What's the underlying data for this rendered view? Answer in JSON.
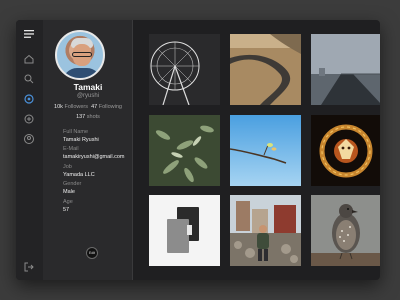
{
  "profile": {
    "name": "Tamaki",
    "handle": "@ryushi",
    "followers_count": "10k",
    "followers_label": "Followers",
    "following_count": "47",
    "following_label": "Following",
    "shots_count": "137",
    "shots_label": "shots",
    "fields": [
      {
        "label": "Full Name",
        "value": "Tamaki Ryushi"
      },
      {
        "label": "E-Mail",
        "value": "tamakiryushi@gmail.com"
      },
      {
        "label": "Job",
        "value": "Yamada LLC"
      },
      {
        "label": "Gender",
        "value": "Male"
      },
      {
        "label": "Age",
        "value": "57"
      }
    ],
    "edit_label": "Edit"
  },
  "nav": {
    "icons": [
      "menu-icon",
      "home-icon",
      "search-icon",
      "settings-icon",
      "add-icon",
      "user-icon",
      "logout-icon"
    ],
    "accent": "#4a90d9"
  },
  "gallery": {
    "photos": [
      "ferris-wheel",
      "winding-road",
      "pier",
      "plants",
      "branch-sky",
      "dragon-ornament",
      "notebook",
      "street-person",
      "bird"
    ]
  }
}
